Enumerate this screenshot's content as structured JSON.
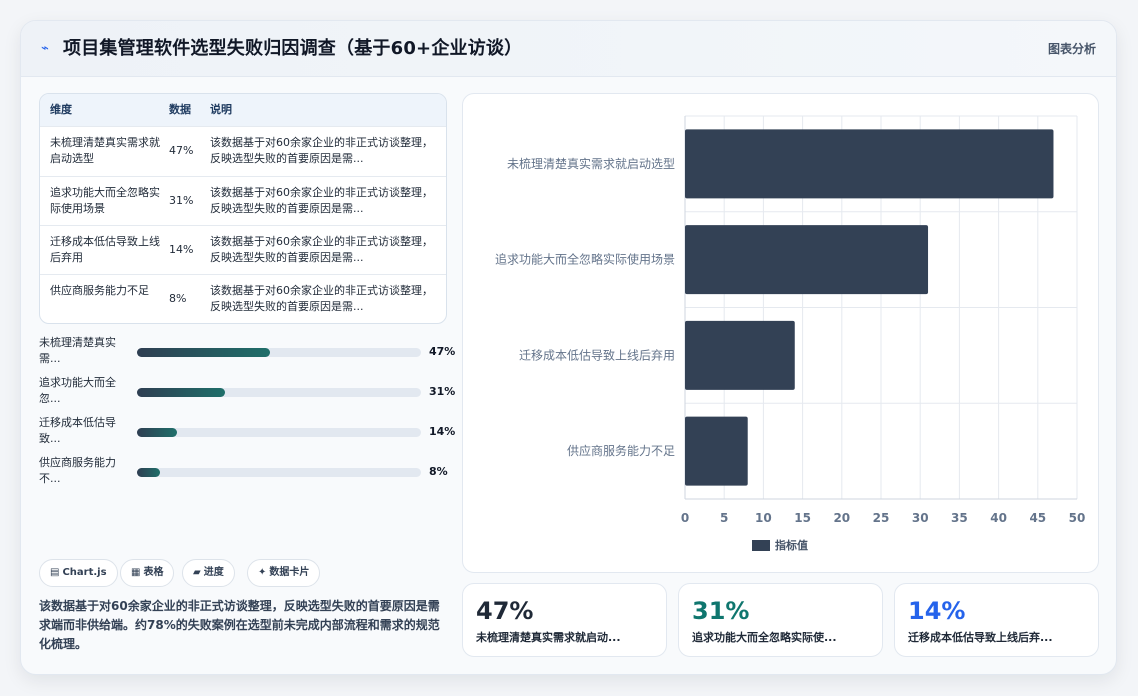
{
  "header": {
    "icon": "trend-line-icon",
    "title": "项目集管理软件选型失败归因调查（基于60+企业访谈）",
    "menu_label": "图表分析"
  },
  "table": {
    "columns": [
      "维度",
      "数据",
      "说明"
    ],
    "rows": [
      {
        "dim": "未梳理清楚真实需求就启动选型",
        "value": "47%",
        "desc": "该数据基于对60余家企业的非正式访谈整理，反映选型失败的首要原因是需..."
      },
      {
        "dim": "追求功能大而全忽略实际使用场景",
        "value": "31%",
        "desc": "该数据基于对60余家企业的非正式访谈整理，反映选型失败的首要原因是需..."
      },
      {
        "dim": "迁移成本低估导致上线后弃用",
        "value": "14%",
        "desc": "该数据基于对60余家企业的非正式访谈整理，反映选型失败的首要原因是需..."
      },
      {
        "dim": "供应商服务能力不足",
        "value": "8%",
        "desc": "该数据基于对60余家企业的非正式访谈整理，反映选型失败的首要原因是需..."
      }
    ]
  },
  "progress": [
    {
      "label": "未梳理清楚真实需...",
      "value": 47,
      "value_label": "47%"
    },
    {
      "label": "追求功能大而全忽...",
      "value": 31,
      "value_label": "31%"
    },
    {
      "label": "迁移成本低估导致...",
      "value": 14,
      "value_label": "14%"
    },
    {
      "label": "供应商服务能力不...",
      "value": 8,
      "value_label": "8%"
    }
  ],
  "chips": [
    {
      "icon": "▤",
      "label": "Chart.js"
    },
    {
      "icon": "▦",
      "label": "表格"
    },
    {
      "icon": "▰",
      "label": "进度"
    },
    {
      "icon": "✦",
      "label": "数据卡片"
    }
  ],
  "summary": "该数据基于对60余家企业的非正式访谈整理，反映选型失败的首要原因是需求端而非供给端。约78%的失败案例在选型前未完成内部流程和需求的规范化梳理。",
  "stats": [
    {
      "value": "47%",
      "label": "未梳理清楚真实需求就启动...",
      "color": "#1f2937"
    },
    {
      "value": "31%",
      "label": "追求功能大而全忽略实际使...",
      "color": "#0f766e"
    },
    {
      "value": "14%",
      "label": "迁移成本低估导致上线后弃...",
      "color": "#2563eb"
    }
  ],
  "chart_data": {
    "type": "bar",
    "orientation": "horizontal",
    "categories": [
      "未梳理清楚真实需求就启动选型",
      "追求功能大而全忽略实际使用场景",
      "迁移成本低估导致上线后弃用",
      "供应商服务能力不足"
    ],
    "series": [
      {
        "name": "指标值",
        "values": [
          47,
          31,
          14,
          8
        ]
      }
    ],
    "xlim": [
      0,
      50
    ],
    "xticks": [
      0,
      5,
      10,
      15,
      20,
      25,
      30,
      35,
      40,
      45,
      50
    ],
    "grid": true,
    "legend": "bottom",
    "bar_color": "#334155"
  }
}
